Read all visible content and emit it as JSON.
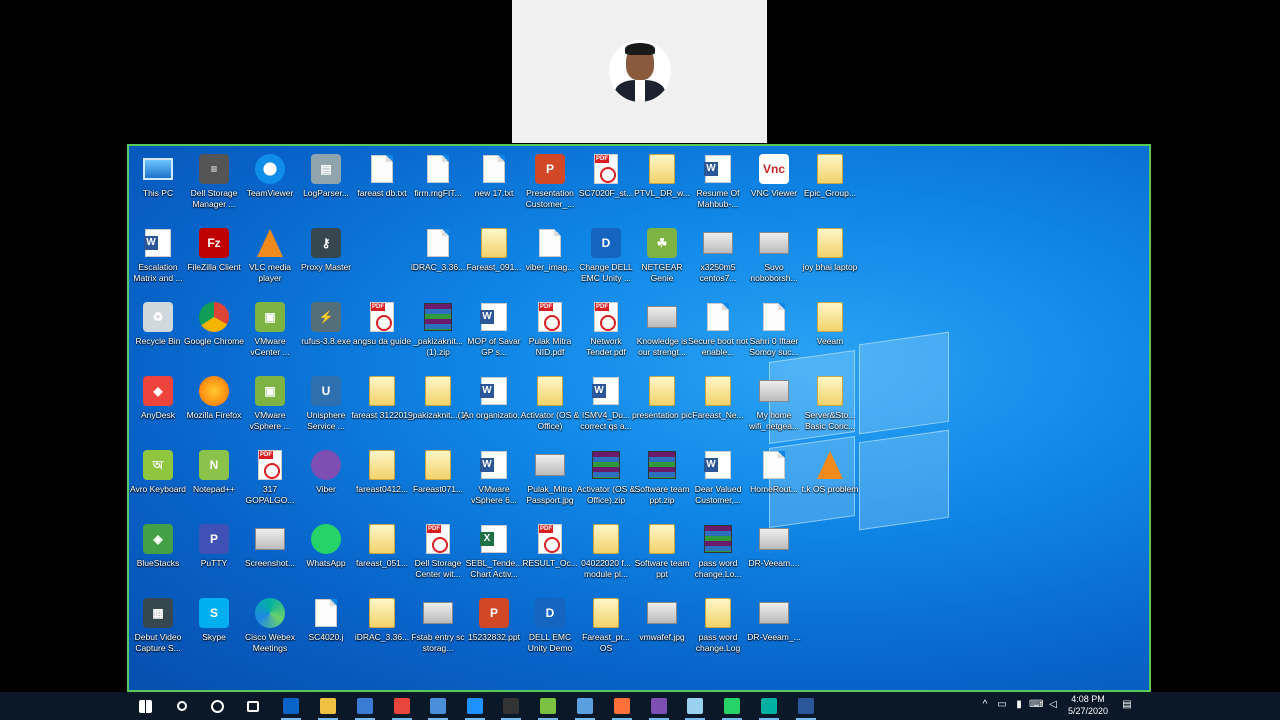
{
  "clock": {
    "time": "4:08 PM",
    "date": "5/27/2020"
  },
  "desktop_icons": [
    {
      "label": "This PC",
      "icon": "monitor-icon"
    },
    {
      "label": "Dell Storage Manager ...",
      "icon": "database-icon"
    },
    {
      "label": "TeamViewer",
      "icon": "teamviewer-icon"
    },
    {
      "label": "LogParser...",
      "icon": "logparser-icon"
    },
    {
      "label": "fareast db.txt",
      "icon": "text-file-icon"
    },
    {
      "label": "firm.mgFIT...",
      "icon": "file-icon"
    },
    {
      "label": "new 17.txt",
      "icon": "text-file-icon"
    },
    {
      "label": "Presentation Customer_...",
      "icon": "powerpoint-icon"
    },
    {
      "label": "SC7020F_st...",
      "icon": "pdf-icon"
    },
    {
      "label": "PTVL_DR_w...",
      "icon": "archive-icon"
    },
    {
      "label": "Resume Of Mahbub-...",
      "icon": "word-icon"
    },
    {
      "label": "VNC Viewer",
      "icon": "vnc-icon"
    },
    {
      "label": "Epic_Group...",
      "icon": "folder-icon"
    },
    {
      "label": "Escalation Matrix and ...",
      "icon": "word-icon"
    },
    {
      "label": "FileZilla Client",
      "icon": "filezilla-icon"
    },
    {
      "label": "VLC media player",
      "icon": "vlc-icon"
    },
    {
      "label": "Proxy Master",
      "icon": "key-icon"
    },
    {
      "label": "iDRAC_3.36...",
      "icon": "file-icon"
    },
    {
      "label": "Fareast_091...",
      "icon": "folder-icon"
    },
    {
      "label": "viber_imag...",
      "icon": "file-icon"
    },
    {
      "label": "Change DELL EMC Unity ...",
      "icon": "dell-icon"
    },
    {
      "label": "NETGEAR Genie",
      "icon": "genie-icon"
    },
    {
      "label": "x3250m5 centos7...",
      "icon": "image-icon"
    },
    {
      "label": "Suvo noboborsh...",
      "icon": "image-icon"
    },
    {
      "label": "joy bhai laptop",
      "icon": "folder-icon"
    },
    {
      "label": "Recycle Bin",
      "icon": "recycle-bin-icon"
    },
    {
      "label": "Google Chrome",
      "icon": "chrome-icon"
    },
    {
      "label": "VMware vCenter ...",
      "icon": "vmware-icon"
    },
    {
      "label": "rufus-3.8.exe",
      "icon": "usb-icon"
    },
    {
      "label": "angsu da guide",
      "icon": "pdf-icon"
    },
    {
      "label": "_pakizaknit...(1).zip",
      "icon": "winrar-icon"
    },
    {
      "label": "MOP of Savar GP s...",
      "icon": "word-icon"
    },
    {
      "label": "Pulak Mitra NID.pdf",
      "icon": "pdf-icon"
    },
    {
      "label": "Network Tender.pdf",
      "icon": "pdf-icon"
    },
    {
      "label": "Knowledge is our strengt...",
      "icon": "image-icon"
    },
    {
      "label": "Secure boot not enable...",
      "icon": "file-icon"
    },
    {
      "label": "Sahri 0 Iftaer Somoy suc...",
      "icon": "file-icon"
    },
    {
      "label": "Veeam",
      "icon": "folder-icon"
    },
    {
      "label": "AnyDesk",
      "icon": "anydesk-icon"
    },
    {
      "label": "Mozilla Firefox",
      "icon": "firefox-icon"
    },
    {
      "label": "VMware vSphere ...",
      "icon": "vmware-icon"
    },
    {
      "label": "Unisphere Service ...",
      "icon": "unisphere-icon"
    },
    {
      "label": "fareast 3122019",
      "icon": "folder-icon"
    },
    {
      "label": "_pakizaknit...(1)",
      "icon": "folder-icon"
    },
    {
      "label": "An organizatio...",
      "icon": "word-icon"
    },
    {
      "label": "Activator (OS & Office)",
      "icon": "folder-icon"
    },
    {
      "label": "ISMV4_Du... correct qs a...",
      "icon": "word-icon"
    },
    {
      "label": "presentation pic",
      "icon": "folder-icon"
    },
    {
      "label": "Fareast_Ne...",
      "icon": "folder-icon"
    },
    {
      "label": "My home wifi_netgea...",
      "icon": "image-icon"
    },
    {
      "label": "Server&Sto... Basic Conc...",
      "icon": "archive-icon"
    },
    {
      "label": "Avro Keyboard",
      "icon": "avro-icon"
    },
    {
      "label": "Notepad++",
      "icon": "notepad-icon"
    },
    {
      "label": "317 GOPALGO...",
      "icon": "pdf-icon"
    },
    {
      "label": "Viber",
      "icon": "viber-icon"
    },
    {
      "label": "fareast0412...",
      "icon": "folder-icon"
    },
    {
      "label": "Fareast071...",
      "icon": "folder-icon"
    },
    {
      "label": "VMware vSphere 6...",
      "icon": "word-icon"
    },
    {
      "label": "Pulak_Mitra Passport.jpg",
      "icon": "image-icon"
    },
    {
      "label": "Activator (OS & Office).zip",
      "icon": "winrar-icon"
    },
    {
      "label": "Software team ppt.zip",
      "icon": "winrar-icon"
    },
    {
      "label": "Dear Valued Customer,...",
      "icon": "word-icon"
    },
    {
      "label": "HomeRout...",
      "icon": "text-file-icon"
    },
    {
      "label": "t.k OS problem",
      "icon": "vlc-icon"
    },
    {
      "label": "BlueStacks",
      "icon": "bluestacks-icon"
    },
    {
      "label": "PuTTY",
      "icon": "putty-icon"
    },
    {
      "label": "Screenshot...",
      "icon": "image-icon"
    },
    {
      "label": "WhatsApp",
      "icon": "whatsapp-icon"
    },
    {
      "label": "fareast_051...",
      "icon": "archive-icon"
    },
    {
      "label": "Dell Storage Center wit...",
      "icon": "pdf-icon"
    },
    {
      "label": "SEBL_Tende... Chart Activ...",
      "icon": "excel-icon"
    },
    {
      "label": "RESULT_Oc...",
      "icon": "pdf-icon"
    },
    {
      "label": "04022020 f... module pl...",
      "icon": "archive-icon"
    },
    {
      "label": "Software team ppt",
      "icon": "folder-icon"
    },
    {
      "label": "pass word change.Lo...",
      "icon": "winrar-icon"
    },
    {
      "label": "DR-Veeam....",
      "icon": "image-icon"
    },
    {
      "label": "Debut Video Capture S...",
      "icon": "film-icon"
    },
    {
      "label": "Skype",
      "icon": "skype-icon"
    },
    {
      "label": "Cisco Webex Meetings",
      "icon": "webex-icon"
    },
    {
      "label": "SC4020.j",
      "icon": "file-icon"
    },
    {
      "label": "iDRAC_3.36...",
      "icon": "archive-icon"
    },
    {
      "label": "Fstab entry sc storag...",
      "icon": "image-icon"
    },
    {
      "label": "15232832.ppt",
      "icon": "powerpoint-icon"
    },
    {
      "label": "DELL EMC Unity Demo",
      "icon": "dell-icon"
    },
    {
      "label": "Fareast_pr... OS",
      "icon": "folder-icon"
    },
    {
      "label": "vmwafef.jpg",
      "icon": "image-icon"
    },
    {
      "label": "pass word change.Log",
      "icon": "archive-icon"
    },
    {
      "label": "DR-Veeam_...",
      "icon": "image-icon"
    }
  ],
  "taskbar": [
    {
      "name": "start-icon",
      "color": "#ffffff"
    },
    {
      "name": "search-icon",
      "color": "#ffffff"
    },
    {
      "name": "cortana-icon",
      "color": "#ffffff"
    },
    {
      "name": "task-view-icon",
      "color": "#ffffff"
    },
    {
      "name": "outlook-icon",
      "color": "#0a64c8"
    },
    {
      "name": "file-explorer-icon",
      "color": "#f0c040"
    },
    {
      "name": "remote-desktop-icon",
      "color": "#3a7bd5"
    },
    {
      "name": "chrome-icon",
      "color": "#e8453c"
    },
    {
      "name": "network-tool-icon",
      "color": "#4a90d9"
    },
    {
      "name": "edge-icon",
      "color": "#1e90ff"
    },
    {
      "name": "terminal-icon",
      "color": "#333333"
    },
    {
      "name": "notepadpp-icon",
      "color": "#7cc242"
    },
    {
      "name": "server-manager-icon",
      "color": "#5aa0e0"
    },
    {
      "name": "firefox-icon",
      "color": "#ff7139"
    },
    {
      "name": "viber-icon",
      "color": "#7d4eb4"
    },
    {
      "name": "app-icon",
      "color": "#9ad0f0"
    },
    {
      "name": "whatsapp-icon",
      "color": "#25d366"
    },
    {
      "name": "webex-icon",
      "color": "#00b0a0"
    },
    {
      "name": "word-icon",
      "color": "#2b579a"
    }
  ]
}
